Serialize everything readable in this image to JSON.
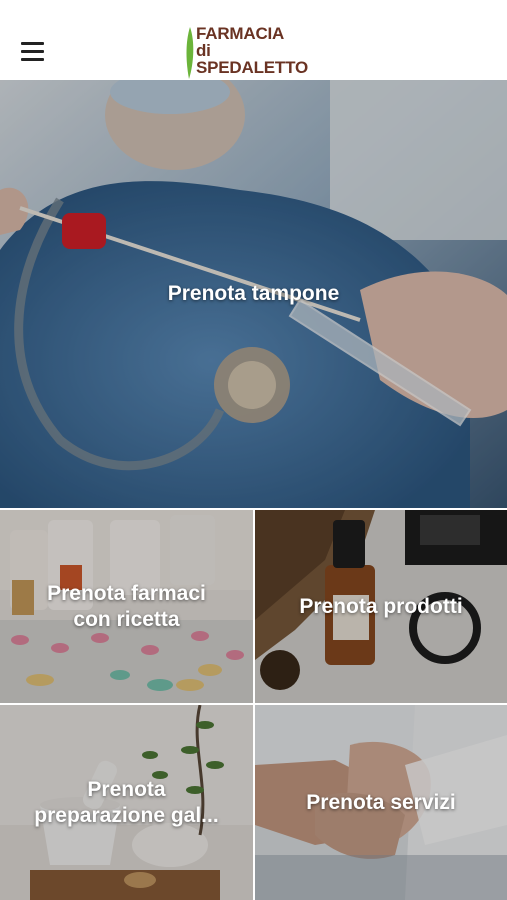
{
  "header": {
    "logo": {
      "line1": "FARMACIA",
      "line2": "di",
      "line3": "SPEDALETTO"
    },
    "icons": {
      "menu": "hamburger-menu-icon",
      "logo_mark": "green-leaf-icon"
    }
  },
  "tiles": {
    "hero": {
      "label": "Prenota tampone"
    },
    "farmaci": {
      "line1": "Prenota farmaci",
      "line2": "con ricetta"
    },
    "prodotti": {
      "label": "Prenota prodotti"
    },
    "galenica": {
      "line1": "Prenota",
      "line2": "preparazione gal..."
    },
    "servizi": {
      "label": "Prenota servizi"
    }
  },
  "colors": {
    "logo_text": "#6a3323",
    "logo_leaf": "#6bb43a",
    "label_text": "#ffffff"
  }
}
